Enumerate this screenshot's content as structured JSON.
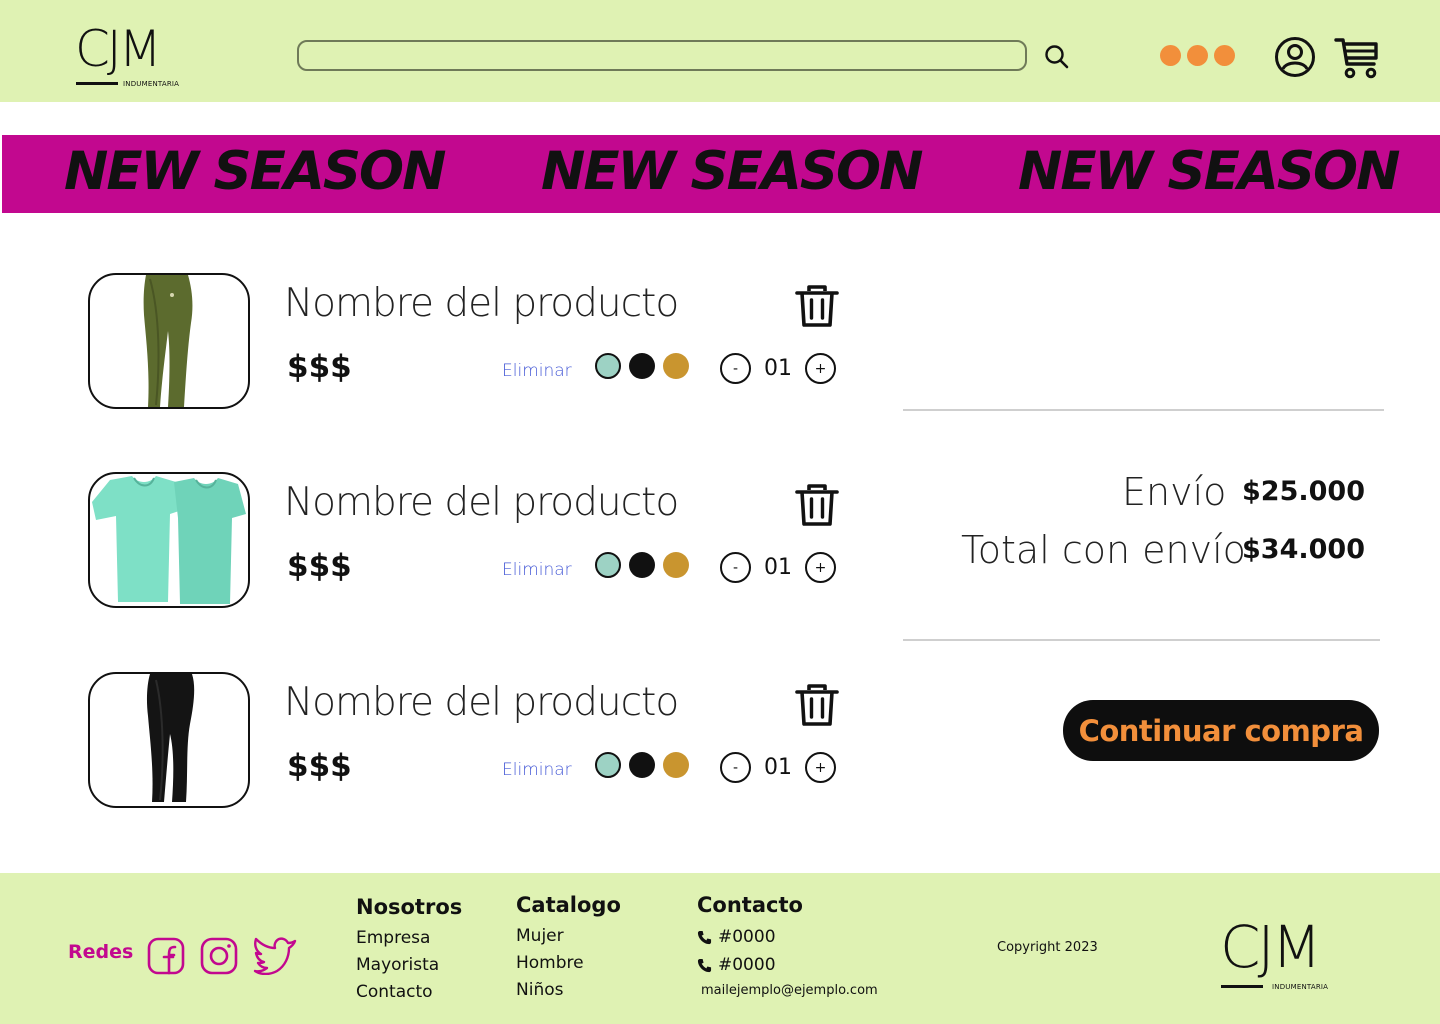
{
  "header": {
    "logo": {
      "mark": "CJM",
      "subtitle": "INDUMENTARIA"
    },
    "search": {
      "value": "",
      "placeholder": ""
    },
    "icons": [
      "search-icon",
      "more-options-icon",
      "user-account-icon",
      "shopping-cart-icon"
    ]
  },
  "banner": {
    "items": [
      "NEW SEASON",
      "NEW SEASON",
      "NEW SEASON"
    ]
  },
  "cart": {
    "items": [
      {
        "name": "Nombre del producto",
        "price": "$$$",
        "remove_label": "Eliminar",
        "quantity": "01",
        "decrement": "-",
        "increment": "+",
        "image": "olive-leggings",
        "colors": [
          "#9dd2c4",
          "#111111",
          "#c9952f"
        ]
      },
      {
        "name": "Nombre del producto",
        "price": "$$$",
        "remove_label": "Eliminar",
        "quantity": "01",
        "decrement": "-",
        "increment": "+",
        "image": "mint-t-shirts",
        "colors": [
          "#9dd2c4",
          "#111111",
          "#c9952f"
        ]
      },
      {
        "name": "Nombre del producto",
        "price": "$$$",
        "remove_label": "Eliminar",
        "quantity": "01",
        "decrement": "-",
        "increment": "+",
        "image": "black-leggings",
        "colors": [
          "#9dd2c4",
          "#111111",
          "#c9952f"
        ]
      }
    ]
  },
  "summary": {
    "shipping_label": "Envío",
    "shipping_value": "$25.000",
    "total_label": "Total con envío",
    "total_value": "$34.000",
    "continue_label": "Continuar compra"
  },
  "footer": {
    "redes_label": "Redes",
    "social": [
      "facebook-icon",
      "instagram-icon",
      "twitter-icon"
    ],
    "nosotros": {
      "title": "Nosotros",
      "links": [
        "Empresa",
        "Mayorista",
        "Contacto"
      ]
    },
    "catalogo": {
      "title": "Catalogo",
      "links": [
        "Mujer",
        "Hombre",
        "Niños"
      ]
    },
    "contacto": {
      "title": "Contacto",
      "phones": [
        "#0000",
        "#0000"
      ],
      "email": "mailejemplo@ejemplo.com"
    },
    "copyright": "Copyright 2023",
    "logo": {
      "mark": "CJM",
      "subtitle": "INDUMENTARIA"
    }
  },
  "colors": {
    "header_bg": "#dff2b3",
    "banner_bg": "#c2088f",
    "accent_orange": "#f28f3b",
    "link_blue": "#4559d6",
    "button_bg": "#0e0e0e"
  }
}
